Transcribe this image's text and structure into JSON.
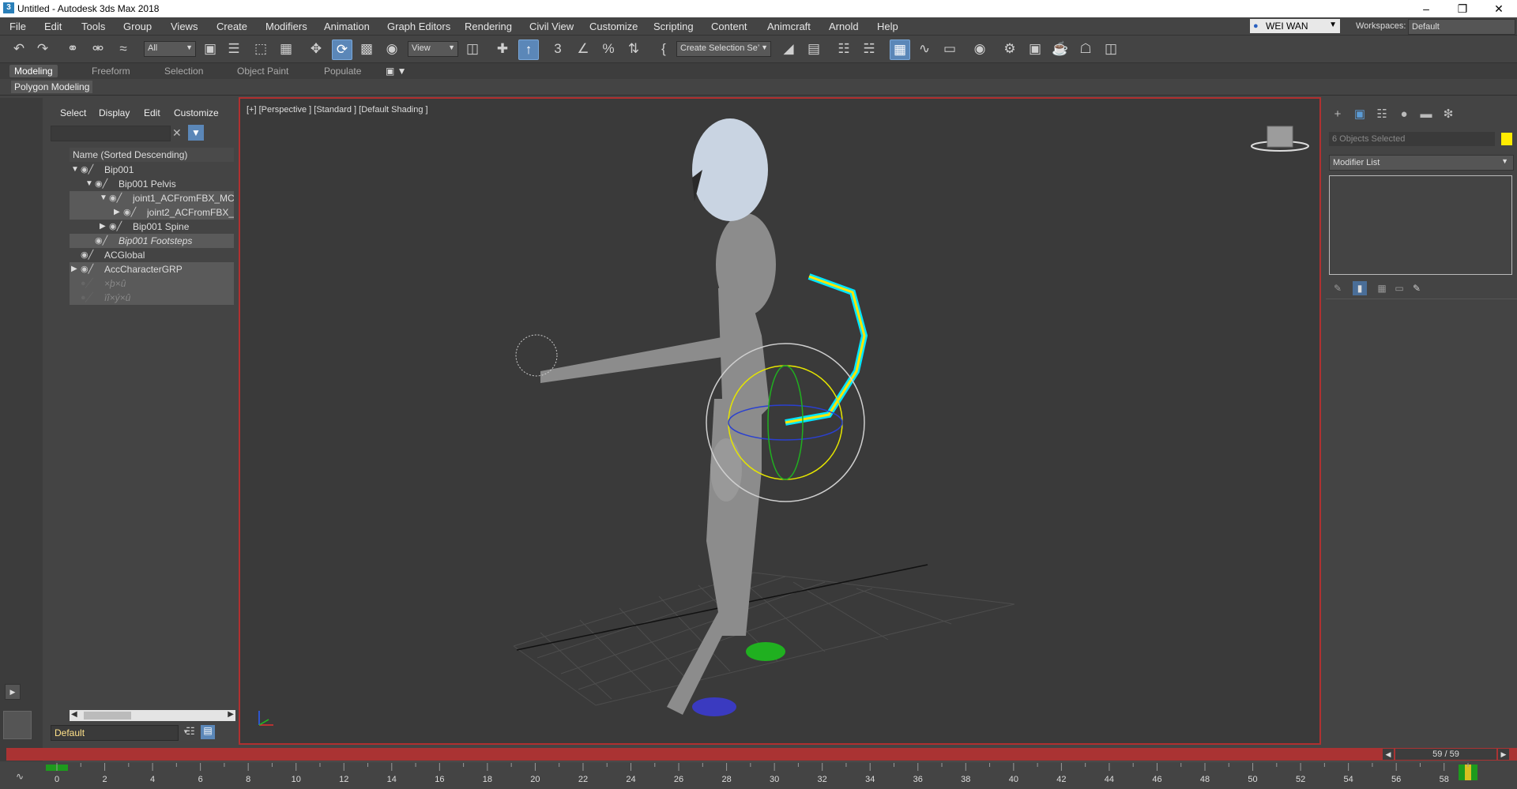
{
  "window": {
    "title": "Untitled - Autodesk 3ds Max 2018"
  },
  "menu": [
    "File",
    "Edit",
    "Tools",
    "Group",
    "Views",
    "Create",
    "Modifiers",
    "Animation",
    "Graph Editors",
    "Rendering",
    "Civil View",
    "Customize",
    "Scripting",
    "Content",
    "Animcraft",
    "Arnold",
    "Help"
  ],
  "user": {
    "name": "WEI WAN"
  },
  "workspace": {
    "label": "Workspaces:",
    "value": "Default"
  },
  "toolbar": {
    "filter": "All",
    "ref_coord": "View",
    "selection_set": "Create Selection Se’"
  },
  "ribbon": {
    "tabs": [
      "Modeling",
      "Freeform",
      "Selection",
      "Object Paint",
      "Populate"
    ],
    "active_tab": "Modeling",
    "sub": "Polygon Modeling"
  },
  "explorer": {
    "menu": [
      "Select",
      "Display",
      "Edit",
      "Customize"
    ],
    "header": "Name (Sorted Descending)",
    "rows": [
      {
        "label": "Bip001",
        "indent": 0,
        "arrow": "down",
        "eye": true
      },
      {
        "label": "Bip001 Pelvis",
        "indent": 1,
        "arrow": "down",
        "eye": true
      },
      {
        "label": "joint1_ACFromFBX_MC",
        "indent": 2,
        "arrow": "down",
        "eye": true
      },
      {
        "label": "joint2_ACFromFBX_",
        "indent": 3,
        "arrow": "right",
        "eye": true
      },
      {
        "label": "Bip001 Spine",
        "indent": 2,
        "arrow": "right",
        "eye": true
      },
      {
        "label": "Bip001 Footsteps",
        "indent": 1,
        "arrow": "",
        "eye": true,
        "italic": true
      },
      {
        "label": "ACGlobal",
        "indent": 0,
        "arrow": "",
        "eye": true
      },
      {
        "label": "AccCharacterGRP",
        "indent": 0,
        "arrow": "right",
        "eye": true
      },
      {
        "label": "×þ×û",
        "indent": 0,
        "arrow": "",
        "eye": false,
        "dim": true
      },
      {
        "label": "ïî×ý×û",
        "indent": 0,
        "arrow": "",
        "eye": false,
        "dim": true
      }
    ],
    "layer": "Default"
  },
  "viewport": {
    "label": "[+] [Perspective ] [Standard ] [Default Shading ]"
  },
  "command_panel": {
    "selection": "6 Objects Selected",
    "selection_color": "#ffeb00",
    "modifier_list": "Modifier List"
  },
  "timeline": {
    "frame": "59 / 59",
    "ticks": [
      "0",
      "2",
      "4",
      "6",
      "8",
      "10",
      "12",
      "14",
      "16",
      "18",
      "20",
      "22",
      "24",
      "26",
      "28",
      "30",
      "32",
      "34",
      "36",
      "38",
      "40",
      "42",
      "44",
      "46",
      "48",
      "50",
      "52",
      "54",
      "56",
      "58"
    ]
  }
}
